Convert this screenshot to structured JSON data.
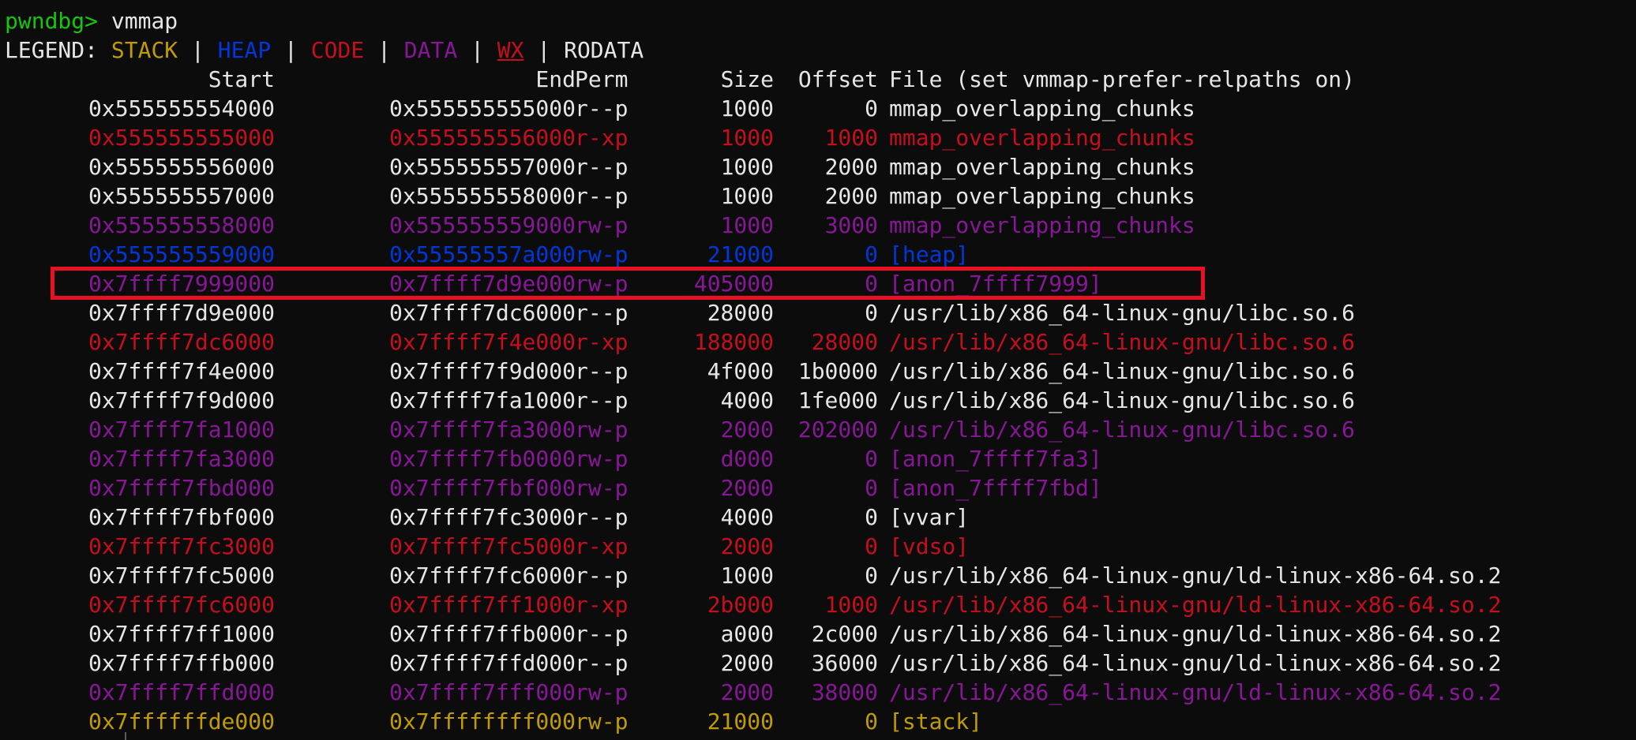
{
  "prompt": {
    "name": "pwndbg>",
    "command": "vmmap"
  },
  "legend": {
    "label": "LEGEND:",
    "separator": "|",
    "items": [
      {
        "text": "STACK",
        "color": "#c19c00"
      },
      {
        "text": "HEAP",
        "color": "#0037da"
      },
      {
        "text": "CODE",
        "color": "#c50f1f"
      },
      {
        "text": "DATA",
        "color": "#881798"
      },
      {
        "text": "WX",
        "color": "#c50f1f"
      },
      {
        "text": "RODATA",
        "color": "#e6e6e6"
      }
    ]
  },
  "columns": {
    "start": "Start",
    "end": "End",
    "perm": "Perm",
    "size": "Size",
    "offset": "Offset",
    "file": "File (set vmmap-prefer-relpaths on)"
  },
  "rows": [
    {
      "start": "0x555555554000",
      "end": "0x555555555000",
      "perm": "r--p",
      "size": "1000",
      "offset": "0",
      "file": "mmap_overlapping_chunks",
      "kind": "rodata"
    },
    {
      "start": "0x555555555000",
      "end": "0x555555556000",
      "perm": "r-xp",
      "size": "1000",
      "offset": "1000",
      "file": "mmap_overlapping_chunks",
      "kind": "code"
    },
    {
      "start": "0x555555556000",
      "end": "0x555555557000",
      "perm": "r--p",
      "size": "1000",
      "offset": "2000",
      "file": "mmap_overlapping_chunks",
      "kind": "rodata"
    },
    {
      "start": "0x555555557000",
      "end": "0x555555558000",
      "perm": "r--p",
      "size": "1000",
      "offset": "2000",
      "file": "mmap_overlapping_chunks",
      "kind": "rodata"
    },
    {
      "start": "0x555555558000",
      "end": "0x555555559000",
      "perm": "rw-p",
      "size": "1000",
      "offset": "3000",
      "file": "mmap_overlapping_chunks",
      "kind": "data"
    },
    {
      "start": "0x555555559000",
      "end": "0x55555557a000",
      "perm": "rw-p",
      "size": "21000",
      "offset": "0",
      "file": "[heap]",
      "kind": "heap"
    },
    {
      "start": "0x7ffff7999000",
      "end": "0x7ffff7d9e000",
      "perm": "rw-p",
      "size": "405000",
      "offset": "0",
      "file": "[anon_7ffff7999]",
      "kind": "data"
    },
    {
      "start": "0x7ffff7d9e000",
      "end": "0x7ffff7dc6000",
      "perm": "r--p",
      "size": "28000",
      "offset": "0",
      "file": "/usr/lib/x86_64-linux-gnu/libc.so.6",
      "kind": "rodata"
    },
    {
      "start": "0x7ffff7dc6000",
      "end": "0x7ffff7f4e000",
      "perm": "r-xp",
      "size": "188000",
      "offset": "28000",
      "file": "/usr/lib/x86_64-linux-gnu/libc.so.6",
      "kind": "code"
    },
    {
      "start": "0x7ffff7f4e000",
      "end": "0x7ffff7f9d000",
      "perm": "r--p",
      "size": "4f000",
      "offset": "1b0000",
      "file": "/usr/lib/x86_64-linux-gnu/libc.so.6",
      "kind": "rodata"
    },
    {
      "start": "0x7ffff7f9d000",
      "end": "0x7ffff7fa1000",
      "perm": "r--p",
      "size": "4000",
      "offset": "1fe000",
      "file": "/usr/lib/x86_64-linux-gnu/libc.so.6",
      "kind": "rodata"
    },
    {
      "start": "0x7ffff7fa1000",
      "end": "0x7ffff7fa3000",
      "perm": "rw-p",
      "size": "2000",
      "offset": "202000",
      "file": "/usr/lib/x86_64-linux-gnu/libc.so.6",
      "kind": "data"
    },
    {
      "start": "0x7ffff7fa3000",
      "end": "0x7ffff7fb0000",
      "perm": "rw-p",
      "size": "d000",
      "offset": "0",
      "file": "[anon_7ffff7fa3]",
      "kind": "data"
    },
    {
      "start": "0x7ffff7fbd000",
      "end": "0x7ffff7fbf000",
      "perm": "rw-p",
      "size": "2000",
      "offset": "0",
      "file": "[anon_7ffff7fbd]",
      "kind": "data"
    },
    {
      "start": "0x7ffff7fbf000",
      "end": "0x7ffff7fc3000",
      "perm": "r--p",
      "size": "4000",
      "offset": "0",
      "file": "[vvar]",
      "kind": "rodata"
    },
    {
      "start": "0x7ffff7fc3000",
      "end": "0x7ffff7fc5000",
      "perm": "r-xp",
      "size": "2000",
      "offset": "0",
      "file": "[vdso]",
      "kind": "code"
    },
    {
      "start": "0x7ffff7fc5000",
      "end": "0x7ffff7fc6000",
      "perm": "r--p",
      "size": "1000",
      "offset": "0",
      "file": "/usr/lib/x86_64-linux-gnu/ld-linux-x86-64.so.2",
      "kind": "rodata"
    },
    {
      "start": "0x7ffff7fc6000",
      "end": "0x7ffff7ff1000",
      "perm": "r-xp",
      "size": "2b000",
      "offset": "1000",
      "file": "/usr/lib/x86_64-linux-gnu/ld-linux-x86-64.so.2",
      "kind": "code"
    },
    {
      "start": "0x7ffff7ff1000",
      "end": "0x7ffff7ffb000",
      "perm": "r--p",
      "size": "a000",
      "offset": "2c000",
      "file": "/usr/lib/x86_64-linux-gnu/ld-linux-x86-64.so.2",
      "kind": "rodata"
    },
    {
      "start": "0x7ffff7ffb000",
      "end": "0x7ffff7ffd000",
      "perm": "r--p",
      "size": "2000",
      "offset": "36000",
      "file": "/usr/lib/x86_64-linux-gnu/ld-linux-x86-64.so.2",
      "kind": "rodata"
    },
    {
      "start": "0x7ffff7ffd000",
      "end": "0x7ffff7fff000",
      "perm": "rw-p",
      "size": "2000",
      "offset": "38000",
      "file": "/usr/lib/x86_64-linux-gnu/ld-linux-x86-64.so.2",
      "kind": "data"
    },
    {
      "start": "0x7ffffffde000",
      "end": "0x7ffffffff000",
      "perm": "rw-p",
      "size": "21000",
      "offset": "0",
      "file": "[stack]",
      "kind": "stack"
    }
  ],
  "kind_colors": {
    "rodata": "#e6e6e6",
    "code": "#c50f1f",
    "data": "#881798",
    "heap": "#0037da",
    "stack": "#c19c00"
  },
  "highlight": {
    "row_index": 6,
    "color": "#e81123"
  }
}
